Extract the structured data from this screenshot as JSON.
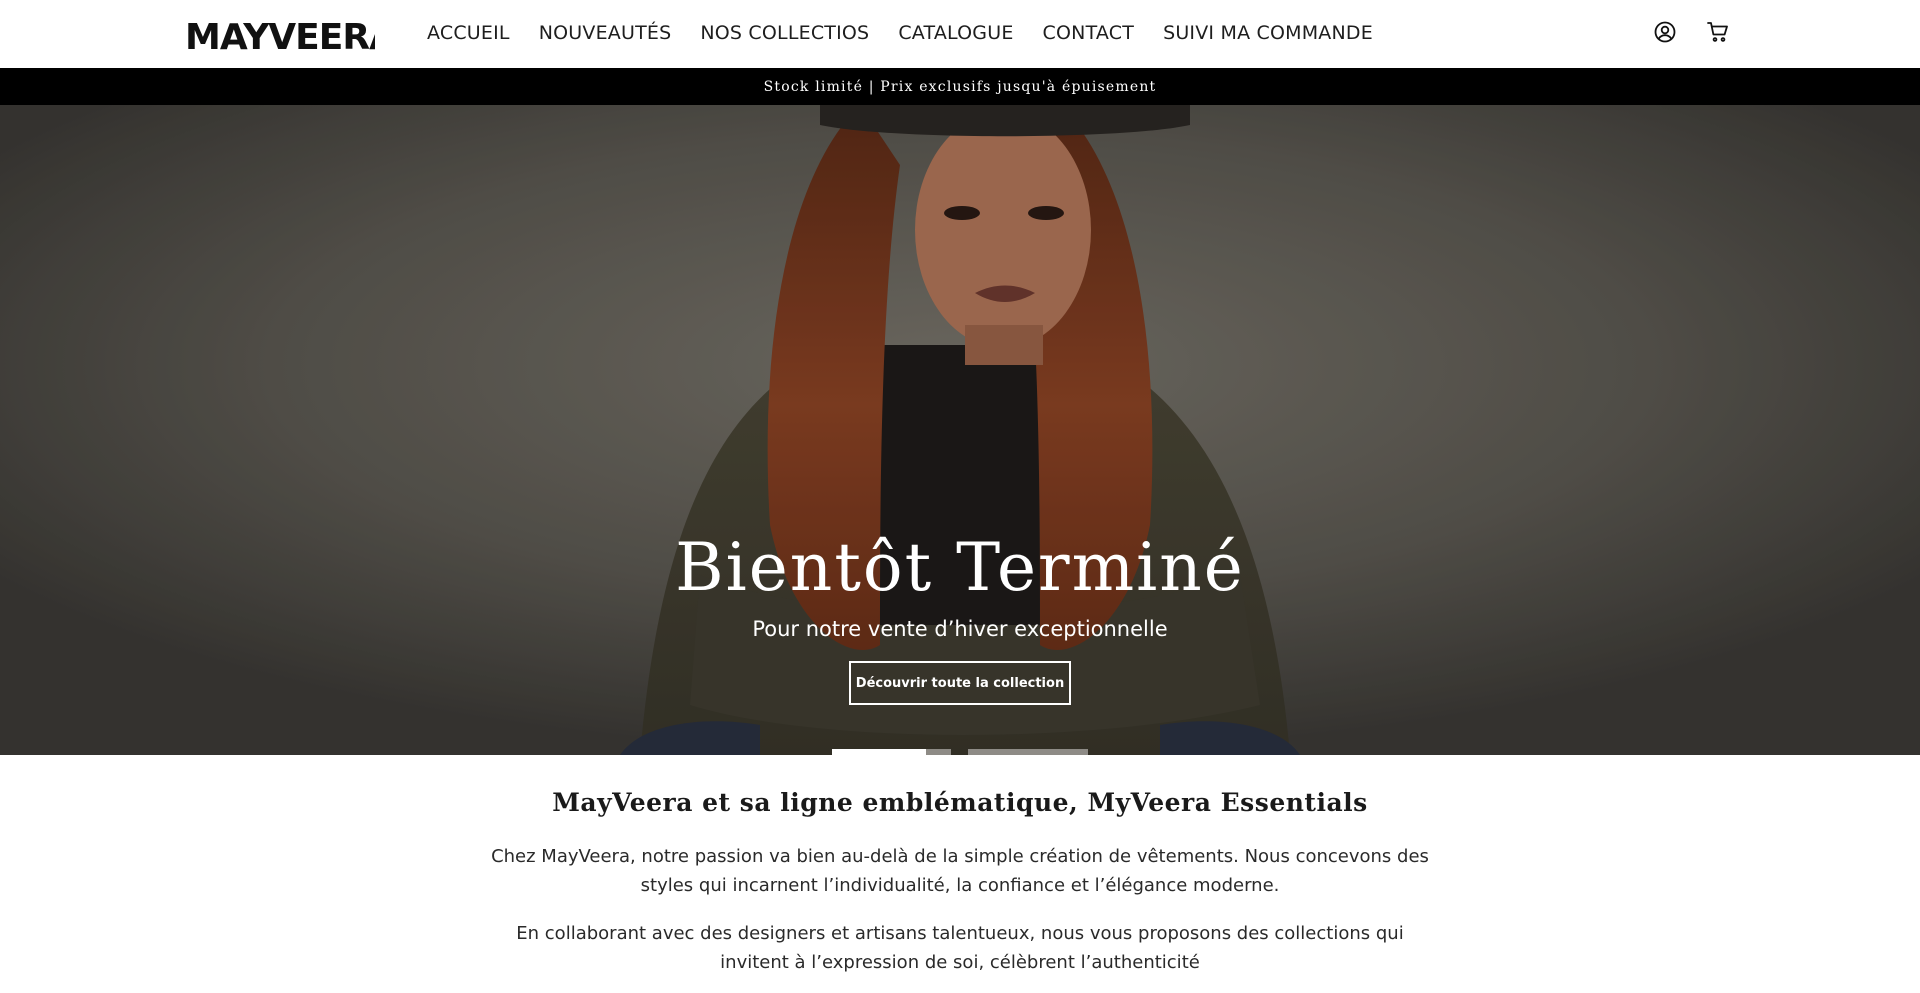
{
  "brand": {
    "logo_text": "MAYVEERA"
  },
  "nav": {
    "items": [
      "ACCUEIL",
      "NOUVEAUTÉS",
      "NOS COLLECTIOS",
      "CATALOGUE",
      "CONTACT",
      "SUIVI MA COMMANDE"
    ]
  },
  "header_icons": [
    "account-icon",
    "cart-icon"
  ],
  "announcement": {
    "text": "Stock limité | Prix exclusifs jusqu'à épuisement"
  },
  "hero": {
    "title": "Bientôt Terminé",
    "subtitle": "Pour notre vente d’hiver exceptionnelle",
    "button_label": "Découvrir toute la collection",
    "slides_total": 2,
    "active_slide": 1
  },
  "about": {
    "title": "MayVeera et sa ligne emblématique, MyVeera Essentials",
    "paragraph_1": "Chez MayVeera, notre passion va bien au-delà de la simple création de vêtements. Nous concevons des styles qui incarnent l’individualité, la confiance et l’élégance moderne.",
    "paragraph_2": "En collaborant avec des designers et artisans talentueux, nous vous proposons des collections qui invitent à l’expression de soi, célèbrent l’authenticité"
  },
  "colors": {
    "announcement_bg": "#000000",
    "text": "#1a1a1a",
    "accent_white": "#ffffff"
  }
}
